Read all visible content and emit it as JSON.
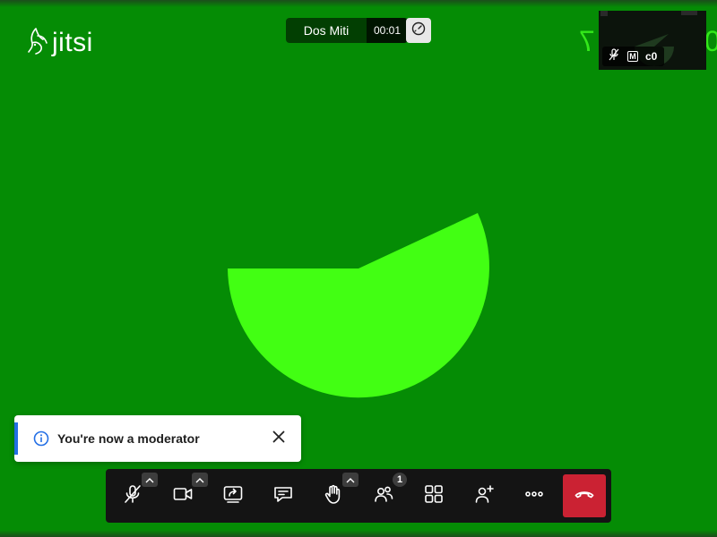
{
  "app": {
    "logo_text": "jitsi"
  },
  "conference": {
    "subject": "Dos Miti",
    "timer": "00:01"
  },
  "remote_video": {
    "mirrored_text": "7",
    "partial_text": "0"
  },
  "thumbnail": {
    "participant_name": "c0",
    "moderator_badge": "M"
  },
  "notification": {
    "message": "You're now a moderator"
  },
  "toolbar": {
    "participants_count": "1"
  },
  "colors": {
    "background": "#058c05",
    "pie": "#42ff13",
    "accent": "#246fe5",
    "hangup": "#cb2233",
    "toolbar": "#141414"
  },
  "icons": {
    "logo": "jitsi-logo-icon",
    "speed": "performance-gauge-icon",
    "mic": "microphone-muted-icon",
    "camera": "camera-icon",
    "share": "screen-share-icon",
    "chat": "chat-icon",
    "raise_hand": "raise-hand-icon",
    "participants": "participants-icon",
    "tile_view": "tile-view-icon",
    "invite": "invite-icon",
    "more": "more-options-icon",
    "hangup": "hangup-icon",
    "info": "info-icon",
    "close": "close-icon"
  }
}
